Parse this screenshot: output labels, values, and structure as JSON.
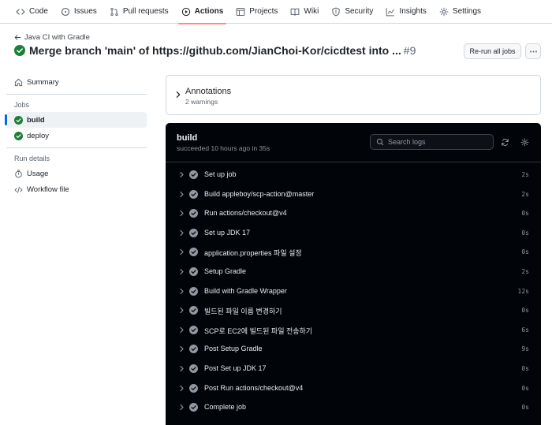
{
  "nav": {
    "items": [
      {
        "label": "Code",
        "icon": "code-icon",
        "active": false
      },
      {
        "label": "Issues",
        "icon": "issue-icon",
        "active": false
      },
      {
        "label": "Pull requests",
        "icon": "pull-request-icon",
        "active": false
      },
      {
        "label": "Actions",
        "icon": "play-icon",
        "active": true
      },
      {
        "label": "Projects",
        "icon": "table-icon",
        "active": false
      },
      {
        "label": "Wiki",
        "icon": "book-icon",
        "active": false
      },
      {
        "label": "Security",
        "icon": "shield-icon",
        "active": false
      },
      {
        "label": "Insights",
        "icon": "graph-icon",
        "active": false
      },
      {
        "label": "Settings",
        "icon": "gear-icon",
        "active": false
      }
    ],
    "accent_color": "#fd8c73"
  },
  "header": {
    "workflow_name": "Java CI with Gradle",
    "run_title": "Merge branch 'main' of https://github.com/JianChoi-Kor/cicdtest into ...",
    "run_number": "#9",
    "rerun_label": "Re-run all jobs",
    "success_color": "#1a7f37"
  },
  "sidebar": {
    "summary_label": "Summary",
    "jobs_heading": "Jobs",
    "jobs": [
      {
        "label": "build",
        "selected": true
      },
      {
        "label": "deploy",
        "selected": false
      }
    ],
    "run_details_heading": "Run details",
    "details": [
      {
        "label": "Usage",
        "icon": "stopwatch-icon"
      },
      {
        "label": "Workflow file",
        "icon": "file-icon"
      }
    ]
  },
  "annotations": {
    "title": "Annotations",
    "subtitle": "2 warnings"
  },
  "log": {
    "job_name": "build",
    "meta": "succeeded 10 hours ago in 35s",
    "search_placeholder": "Search logs",
    "steps": [
      {
        "name": "Set up job",
        "duration": "2s"
      },
      {
        "name": "Build appleboy/scp-action@master",
        "duration": "2s"
      },
      {
        "name": "Run actions/checkout@v4",
        "duration": "0s"
      },
      {
        "name": "Set up JDK 17",
        "duration": "0s"
      },
      {
        "name": "application.properties 파일 설정",
        "duration": "0s"
      },
      {
        "name": "Setup Gradle",
        "duration": "2s"
      },
      {
        "name": "Build with Gradle Wrapper",
        "duration": "12s"
      },
      {
        "name": "빌드된 파일 이름 변경하기",
        "duration": "0s"
      },
      {
        "name": "SCP로 EC2에 빌드된 파일 전송하기",
        "duration": "6s"
      },
      {
        "name": "Post Setup Gradle",
        "duration": "9s"
      },
      {
        "name": "Post Set up JDK 17",
        "duration": "0s"
      },
      {
        "name": "Post Run actions/checkout@v4",
        "duration": "0s"
      },
      {
        "name": "Complete job",
        "duration": "0s"
      }
    ]
  }
}
